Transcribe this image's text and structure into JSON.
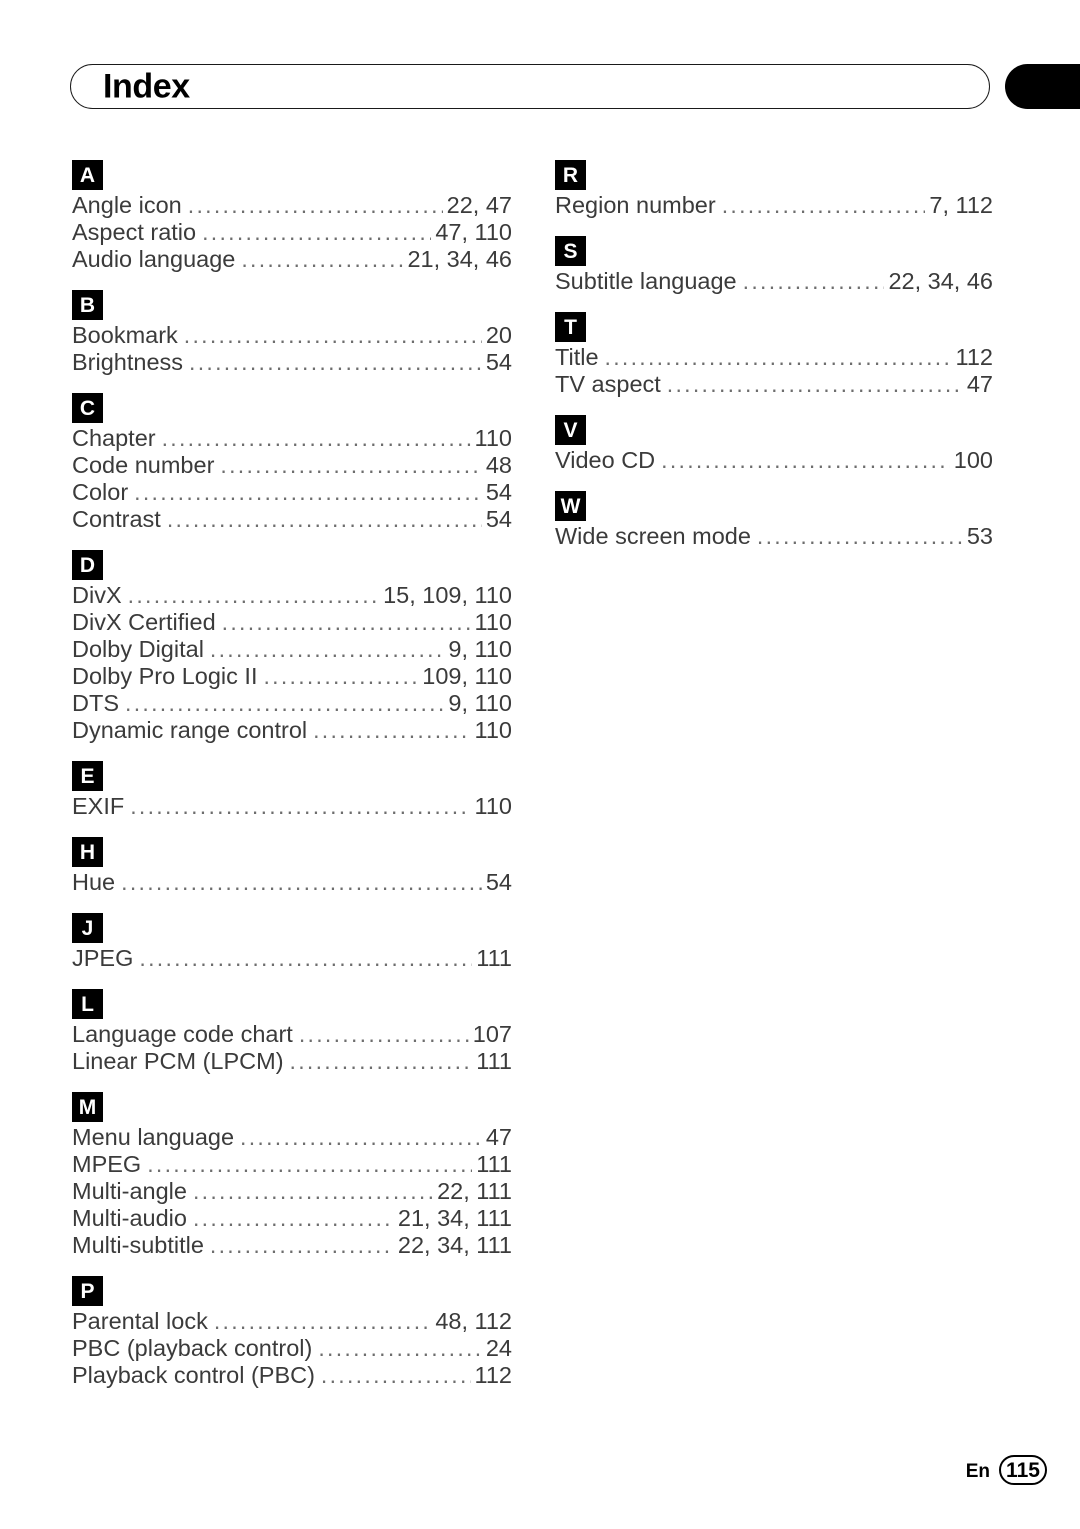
{
  "header": {
    "title": "Index",
    "tab_color": "#000000"
  },
  "columns": [
    {
      "id": "left",
      "sections": [
        {
          "letter": "A",
          "entries": [
            {
              "label": "Angle icon",
              "pages": "22, 47"
            },
            {
              "label": "Aspect ratio",
              "pages": "47, 110"
            },
            {
              "label": "Audio language",
              "pages": "21, 34, 46"
            }
          ]
        },
        {
          "letter": "B",
          "entries": [
            {
              "label": "Bookmark",
              "pages": "20"
            },
            {
              "label": "Brightness",
              "pages": "54"
            }
          ]
        },
        {
          "letter": "C",
          "entries": [
            {
              "label": "Chapter",
              "pages": "110"
            },
            {
              "label": "Code number",
              "pages": "48"
            },
            {
              "label": "Color",
              "pages": "54"
            },
            {
              "label": "Contrast",
              "pages": "54"
            }
          ]
        },
        {
          "letter": "D",
          "entries": [
            {
              "label": "DivX",
              "pages": "15, 109, 110"
            },
            {
              "label": "DivX Certified",
              "pages": "110"
            },
            {
              "label": "Dolby Digital",
              "pages": "9, 110"
            },
            {
              "label": "Dolby Pro Logic II",
              "pages": "109, 110"
            },
            {
              "label": "DTS",
              "pages": "9, 110"
            },
            {
              "label": "Dynamic range control",
              "pages": "110"
            }
          ]
        },
        {
          "letter": "E",
          "entries": [
            {
              "label": "EXIF",
              "pages": "110"
            }
          ]
        },
        {
          "letter": "H",
          "entries": [
            {
              "label": "Hue",
              "pages": "54"
            }
          ]
        },
        {
          "letter": "J",
          "entries": [
            {
              "label": "JPEG",
              "pages": "111"
            }
          ]
        },
        {
          "letter": "L",
          "entries": [
            {
              "label": "Language code chart",
              "pages": "107"
            },
            {
              "label": "Linear PCM (LPCM)",
              "pages": "111"
            }
          ]
        },
        {
          "letter": "M",
          "entries": [
            {
              "label": "Menu language",
              "pages": "47"
            },
            {
              "label": "MPEG",
              "pages": "111"
            },
            {
              "label": "Multi-angle",
              "pages": "22, 111"
            },
            {
              "label": "Multi-audio",
              "pages": "21, 34, 111"
            },
            {
              "label": "Multi-subtitle",
              "pages": "22, 34, 111"
            }
          ]
        },
        {
          "letter": "P",
          "entries": [
            {
              "label": "Parental lock",
              "pages": "48, 112"
            },
            {
              "label": "PBC (playback control)",
              "pages": "24"
            },
            {
              "label": "Playback control (PBC)",
              "pages": "112"
            }
          ]
        }
      ]
    },
    {
      "id": "right",
      "sections": [
        {
          "letter": "R",
          "entries": [
            {
              "label": "Region number",
              "pages": "7, 112"
            }
          ]
        },
        {
          "letter": "S",
          "entries": [
            {
              "label": "Subtitle language",
              "pages": "22, 34, 46"
            }
          ]
        },
        {
          "letter": "T",
          "entries": [
            {
              "label": "Title",
              "pages": "112"
            },
            {
              "label": "TV aspect",
              "pages": "47"
            }
          ]
        },
        {
          "letter": "V",
          "entries": [
            {
              "label": "Video CD",
              "pages": "100"
            }
          ]
        },
        {
          "letter": "W",
          "entries": [
            {
              "label": "Wide screen mode",
              "pages": "53"
            }
          ]
        }
      ]
    }
  ],
  "footer": {
    "language": "En",
    "page_number": "115"
  },
  "leader_dots": "................................................................................................."
}
